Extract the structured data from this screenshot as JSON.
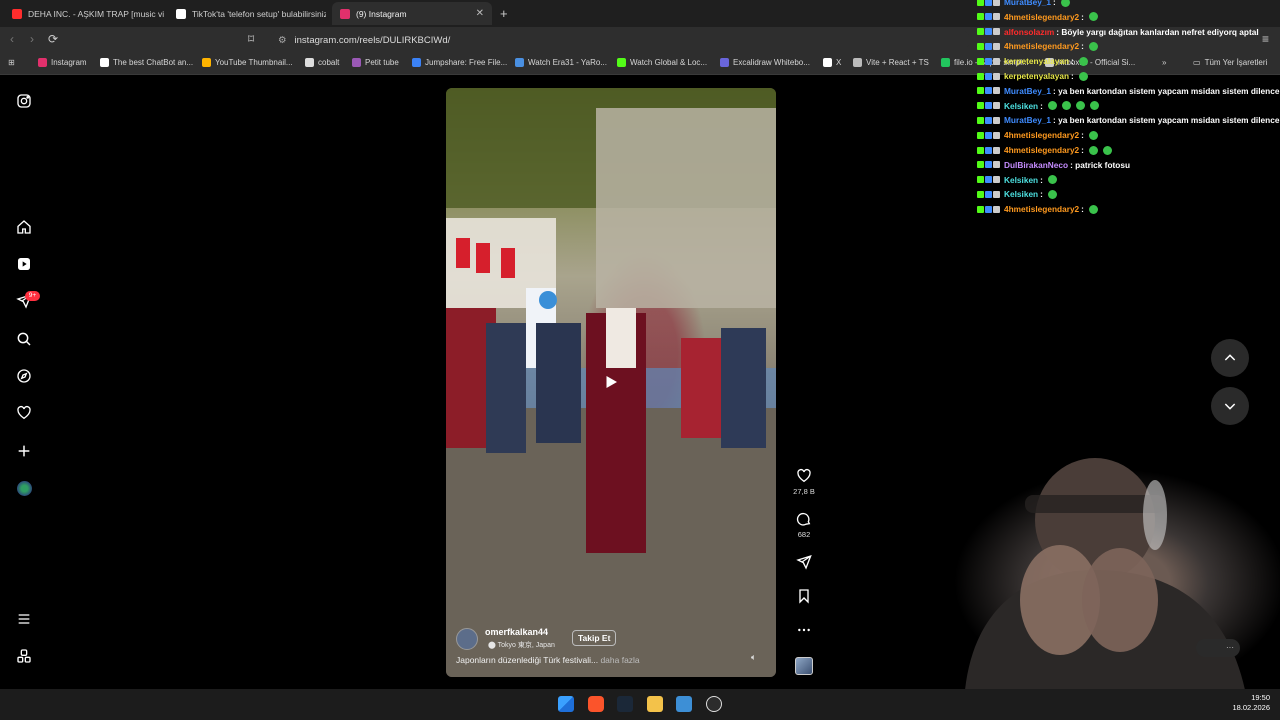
{
  "browser": {
    "tabs": [
      {
        "title": "DEHA INC. - AŞKIM TRAP [music vide",
        "favicon_color": "#ff2d2d"
      },
      {
        "title": "TikTok'ta 'telefon setup' bulabilirsiniz",
        "favicon_color": "#ffffff"
      },
      {
        "title": "(9) Instagram",
        "favicon_color": "#e1306c"
      }
    ],
    "url": "instagram.com/reels/DULIRKBCIWd/",
    "bookmarks": [
      {
        "label": "Instagram",
        "color": "#e1306c"
      },
      {
        "label": "The best ChatBot an...",
        "color": "#ffffff"
      },
      {
        "label": "YouTube Thumbnail...",
        "color": "#ffb400"
      },
      {
        "label": "cobalt",
        "color": "#dddddd"
      },
      {
        "label": "Petit tube",
        "color": "#9b59b6"
      },
      {
        "label": "Jumpshare: Free File...",
        "color": "#3b82f6"
      },
      {
        "label": "Watch Era31 - YaRo...",
        "color": "#4a90e2"
      },
      {
        "label": "Watch Global & Loc...",
        "color": "#53fc18"
      },
      {
        "label": "Excalidraw Whitebo...",
        "color": "#6965db"
      },
      {
        "label": "X",
        "color": "#ffffff"
      },
      {
        "label": "Vite + React + TS",
        "color": "#bbbbbb"
      },
      {
        "label": "file.io - Super simpl...",
        "color": "#22c55e"
      },
      {
        "label": "hitbox.io - Official Si...",
        "color": "#cccccc"
      }
    ],
    "all_bookmarks": "Tüm Yer İşaretleri"
  },
  "reel": {
    "author": "omerfkalkan44",
    "location": "Tokyo 東京, Japan",
    "follow_label": "Takip Et",
    "caption": "Japonların düzenlediği Türk festivali...",
    "more": "daha fazla",
    "likes": "27,8 B",
    "comments": "682"
  },
  "chat": [
    {
      "user": "MuratBey_1",
      "color": "#3f8cff",
      "msg": ":",
      "emotes": 1
    },
    {
      "user": "4hmetislegendary2",
      "color": "#ff9a1f",
      "msg": ":",
      "emotes": 1
    },
    {
      "user": "alfonsolazım",
      "color": "#ff2b2b",
      "msg": ": Böyle yargı dağıtan kanlardan nefret ediyorq aptal",
      "emotes": 0
    },
    {
      "user": "4hmetislegendary2",
      "color": "#ff9a1f",
      "msg": ":",
      "emotes": 1
    },
    {
      "user": "kerpetenyalayan",
      "color": "#e8e84a",
      "msg": ":",
      "emotes": 1
    },
    {
      "user": "kerpetenyalayan",
      "color": "#e8e84a",
      "msg": ":",
      "emotes": 1
    },
    {
      "user": "MuratBey_1",
      "color": "#3f8cff",
      "msg": ": ya ben kartondan sistem yapcam msidan sistem dilencem",
      "emotes": 0
    },
    {
      "user": "Kelsiken",
      "color": "#4de0e0",
      "msg": ":",
      "emotes": 4
    },
    {
      "user": "MuratBey_1",
      "color": "#3f8cff",
      "msg": ": ya ben kartondan sistem yapcam msidan sistem dilencem",
      "emotes": 0
    },
    {
      "user": "4hmetislegendary2",
      "color": "#ff9a1f",
      "msg": ":",
      "emotes": 1
    },
    {
      "user": "4hmetislegendary2",
      "color": "#ff9a1f",
      "msg": ":",
      "emotes": 2
    },
    {
      "user": "DulBirakanNeco",
      "color": "#c58cff",
      "msg": ": patrick fotosu",
      "emotes": 0
    },
    {
      "user": "Kelsiken",
      "color": "#4de0e0",
      "msg": ":",
      "emotes": 1
    },
    {
      "user": "Kelsiken",
      "color": "#4de0e0",
      "msg": ":",
      "emotes": 1
    },
    {
      "user": "4hmetislegendary2",
      "color": "#ff9a1f",
      "msg": ":",
      "emotes": 1
    }
  ],
  "sidebar": {
    "notification_badge": "9+"
  },
  "taskbar": {
    "time": "19:50",
    "date": "18.02.2026"
  }
}
